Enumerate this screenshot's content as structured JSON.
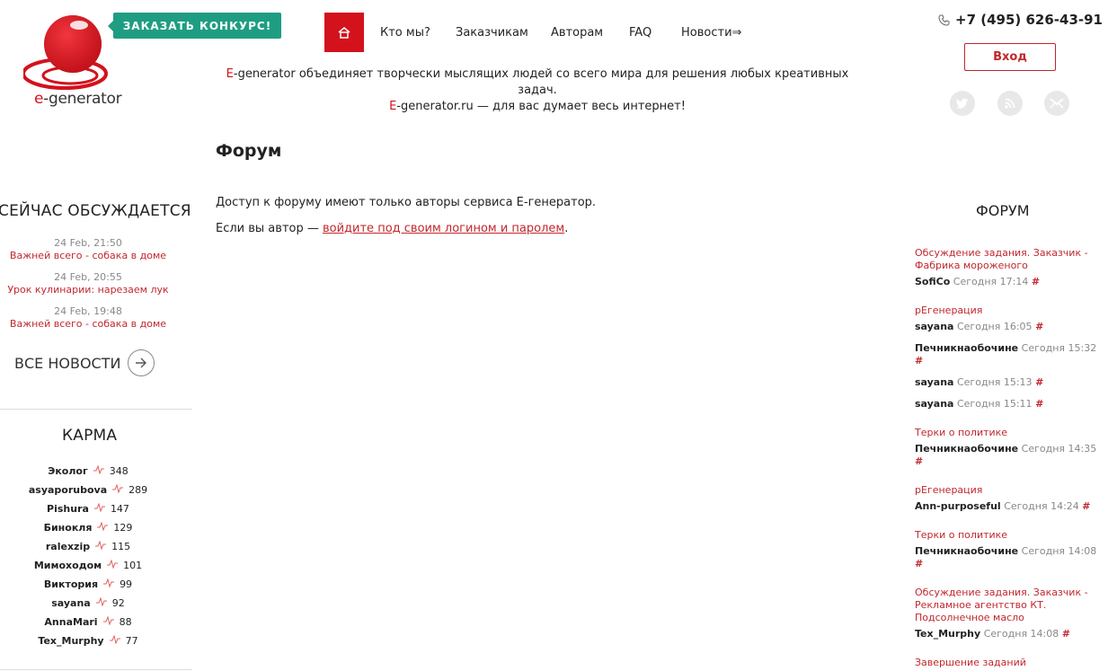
{
  "logo": {
    "text_prefix": "e",
    "text_rest": "-generator"
  },
  "header": {
    "order_button": "ЗАКАЗАТЬ КОНКУРС!",
    "nav": [
      "Кто мы?",
      "Заказчикам",
      "Авторам",
      "FAQ",
      "Новости⇒"
    ],
    "phone": "+7 (495) 626-43-91",
    "login_button": "Вход",
    "tagline_line1_red": "E",
    "tagline_line1_rest": "-generator объединяет творчески мыслящих людей со всего мира для решения любых креативных задач.",
    "tagline_line2_red": "E",
    "tagline_line2_rest": "-generator.ru — для вас думает весь интернет!"
  },
  "main": {
    "title": "Форум",
    "para1": "Доступ к форуму имеют только авторы сервиса E-генератор.",
    "para2_prefix": "Если вы автор — ",
    "para2_link": "войдите под своим логином и паролем",
    "para2_suffix": "."
  },
  "discussed": {
    "title": "СЕЙЧАС ОБСУЖДАЕТСЯ",
    "items": [
      {
        "date": "24 Feb, 21:50",
        "title": "Важней всего - собака в доме"
      },
      {
        "date": "24 Feb, 20:55",
        "title": "Урок кулинарии: нарезаем лук"
      },
      {
        "date": "24 Feb, 19:48",
        "title": "Важней всего - собака в доме"
      }
    ],
    "all_news": "ВСЕ НОВОСТИ"
  },
  "karma": {
    "title": "КАРМА",
    "rows": [
      {
        "name": "Эколог",
        "score": "348"
      },
      {
        "name": "asyaporubova",
        "score": "289"
      },
      {
        "name": "Pishura",
        "score": "147"
      },
      {
        "name": "Бинокля",
        "score": "129"
      },
      {
        "name": "ralexzip",
        "score": "115"
      },
      {
        "name": "Мимоходом",
        "score": "101"
      },
      {
        "name": "Виктория",
        "score": "99"
      },
      {
        "name": "sayana",
        "score": "92"
      },
      {
        "name": "AnnaMari",
        "score": "88"
      },
      {
        "name": "Tex_Murphy",
        "score": "77"
      }
    ]
  },
  "forum": {
    "title": "ФОРУМ",
    "topics": [
      "Обсуждение задания. Заказчик - Фабрика мороженого",
      "рЕгенерация",
      "Терки о политике",
      "рЕгенерация",
      "Терки о политике",
      "Обсуждение задания. Заказчик - Рекламное агентство КТ. Подсолнечное масло",
      "Завершение заданий"
    ],
    "posts": [
      {
        "user": "SofiCo",
        "time": "Сегодня 17:14",
        "hash": "#"
      },
      {
        "user": "sayana",
        "time": "Сегодня 16:05",
        "hash": "#"
      },
      {
        "user": "Печникнаобочине",
        "time": "Сегодня 15:32",
        "hash": "#"
      },
      {
        "user": "sayana",
        "time": "Сегодня 15:13",
        "hash": "#"
      },
      {
        "user": "sayana",
        "time": "Сегодня 15:11",
        "hash": "#"
      },
      {
        "user": "Печникнаобочине",
        "time": "Сегодня 14:35",
        "hash": "#"
      },
      {
        "user": "Ann-purposeful",
        "time": "Сегодня 14:24",
        "hash": "#"
      },
      {
        "user": "Печникнаобочине",
        "time": "Сегодня 14:08",
        "hash": "#"
      },
      {
        "user": "Tex_Murphy",
        "time": "Сегодня 14:08",
        "hash": "#"
      }
    ]
  },
  "colors": {
    "accent": "#d3121c",
    "link": "#c1272d",
    "teal": "#1f9d83"
  },
  "icons": [
    "home-icon",
    "phone-icon",
    "twitter-icon",
    "rss-icon",
    "mail-icon",
    "arrow-right-icon",
    "pulse-icon"
  ]
}
